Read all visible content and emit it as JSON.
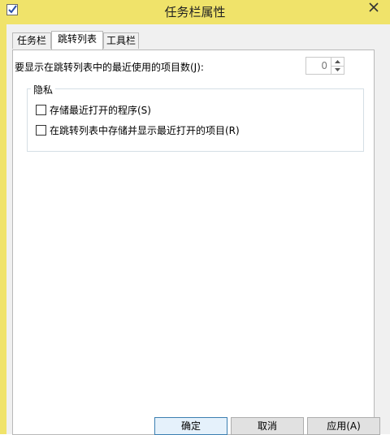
{
  "window": {
    "title": "任务栏属性"
  },
  "tabs": [
    {
      "label": "任务栏"
    },
    {
      "label": "跳转列表"
    },
    {
      "label": "工具栏"
    }
  ],
  "jumplist": {
    "recent_count_label": "要显示在跳转列表中的最近使用的项目数(J):",
    "recent_count_value": "0"
  },
  "privacy": {
    "group_title": "隐私",
    "store_recent_programs": "存储最近打开的程序(S)",
    "store_recent_items": "在跳转列表中存储并显示最近打开的项目(R)"
  },
  "buttons": {
    "ok": "确定",
    "cancel": "取消",
    "apply": "应用(A)"
  },
  "colors": {
    "frame": "#f0e36a",
    "default_button_border": "#3c7fb1"
  }
}
